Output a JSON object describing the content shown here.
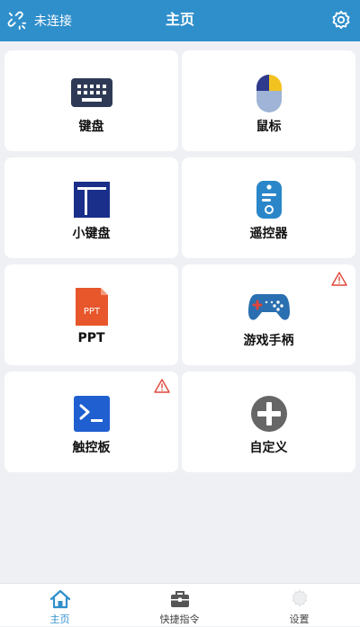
{
  "header": {
    "connection_status": "未连接",
    "title": "主页",
    "connection_icon": "unlinked-icon",
    "settings_icon": "gear-icon"
  },
  "tiles": [
    {
      "label": "键盘",
      "icon": "keyboard-icon",
      "warning": false
    },
    {
      "label": "鼠标",
      "icon": "mouse-icon",
      "warning": false
    },
    {
      "label": "小键盘",
      "icon": "numpad-icon",
      "warning": false
    },
    {
      "label": "遥控器",
      "icon": "remote-control-icon",
      "warning": false
    },
    {
      "label": "PPT",
      "icon": "ppt-file-icon",
      "icon_text": "PPT",
      "warning": false
    },
    {
      "label": "游戏手柄",
      "icon": "gamepad-icon",
      "warning": true
    },
    {
      "label": "触控板",
      "icon": "terminal-touchpad-icon",
      "warning": true
    },
    {
      "label": "自定义",
      "icon": "plus-circle-icon",
      "warning": false
    }
  ],
  "tabs": [
    {
      "label": "主页",
      "icon": "home-icon",
      "active": true
    },
    {
      "label": "快捷指令",
      "icon": "toolbox-icon",
      "active": false
    },
    {
      "label": "设置",
      "icon": "settings-icon",
      "active": false
    }
  ],
  "colors": {
    "header_bg": "#2f8fcb",
    "page_bg": "#eef0f4",
    "warning": "#e0453a",
    "active_tab": "#2f8fcb"
  }
}
